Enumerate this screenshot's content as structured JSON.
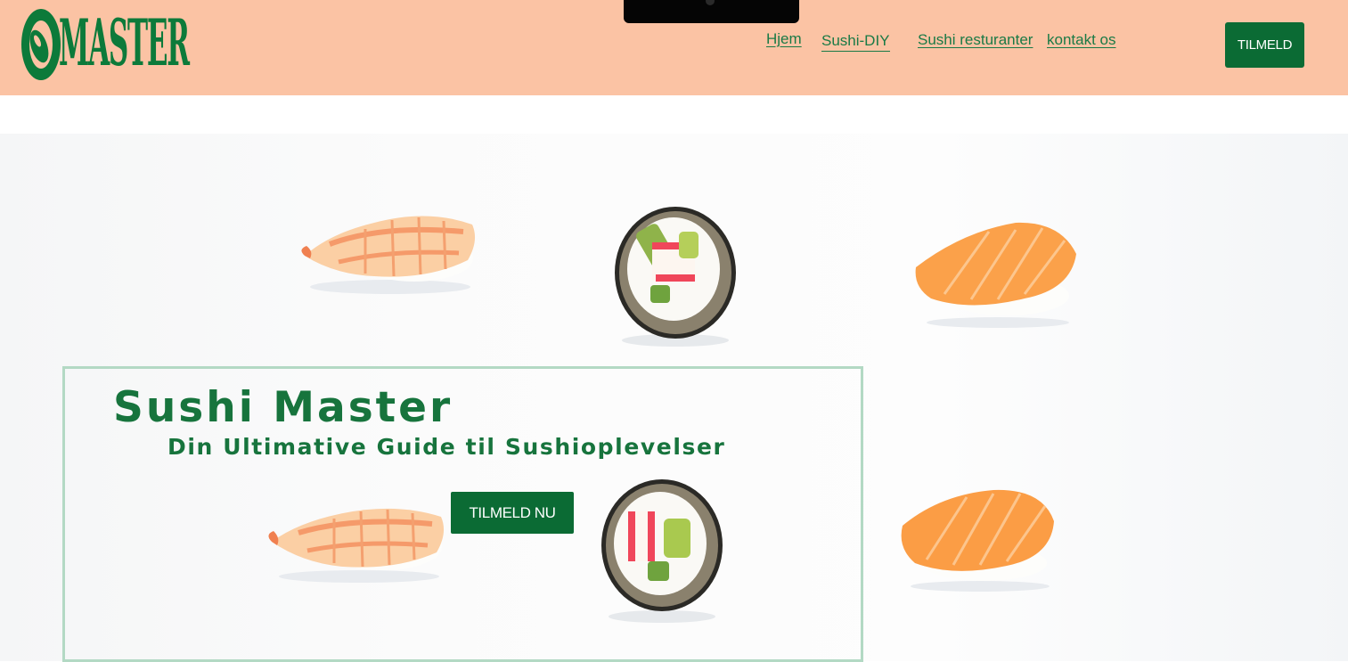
{
  "brand": {
    "logo_text": "MASTER",
    "color": "#0c7a3a"
  },
  "nav": {
    "items": [
      {
        "label": "Hjem"
      },
      {
        "label": "Sushi-DIY"
      },
      {
        "label": "Sushi resturanter"
      },
      {
        "label": "kontakt os"
      }
    ],
    "signup_label": "TILMELD"
  },
  "hero": {
    "title": "Sushi Master",
    "subtitle": "Din Ultimative Guide til Sushioplevelser",
    "cta_label": "TILMELD NU"
  },
  "colors": {
    "header_bg": "#fbc3a4",
    "accent_green": "#0b6b34",
    "text_green": "#17743d",
    "card_border": "#b3d9c4"
  }
}
